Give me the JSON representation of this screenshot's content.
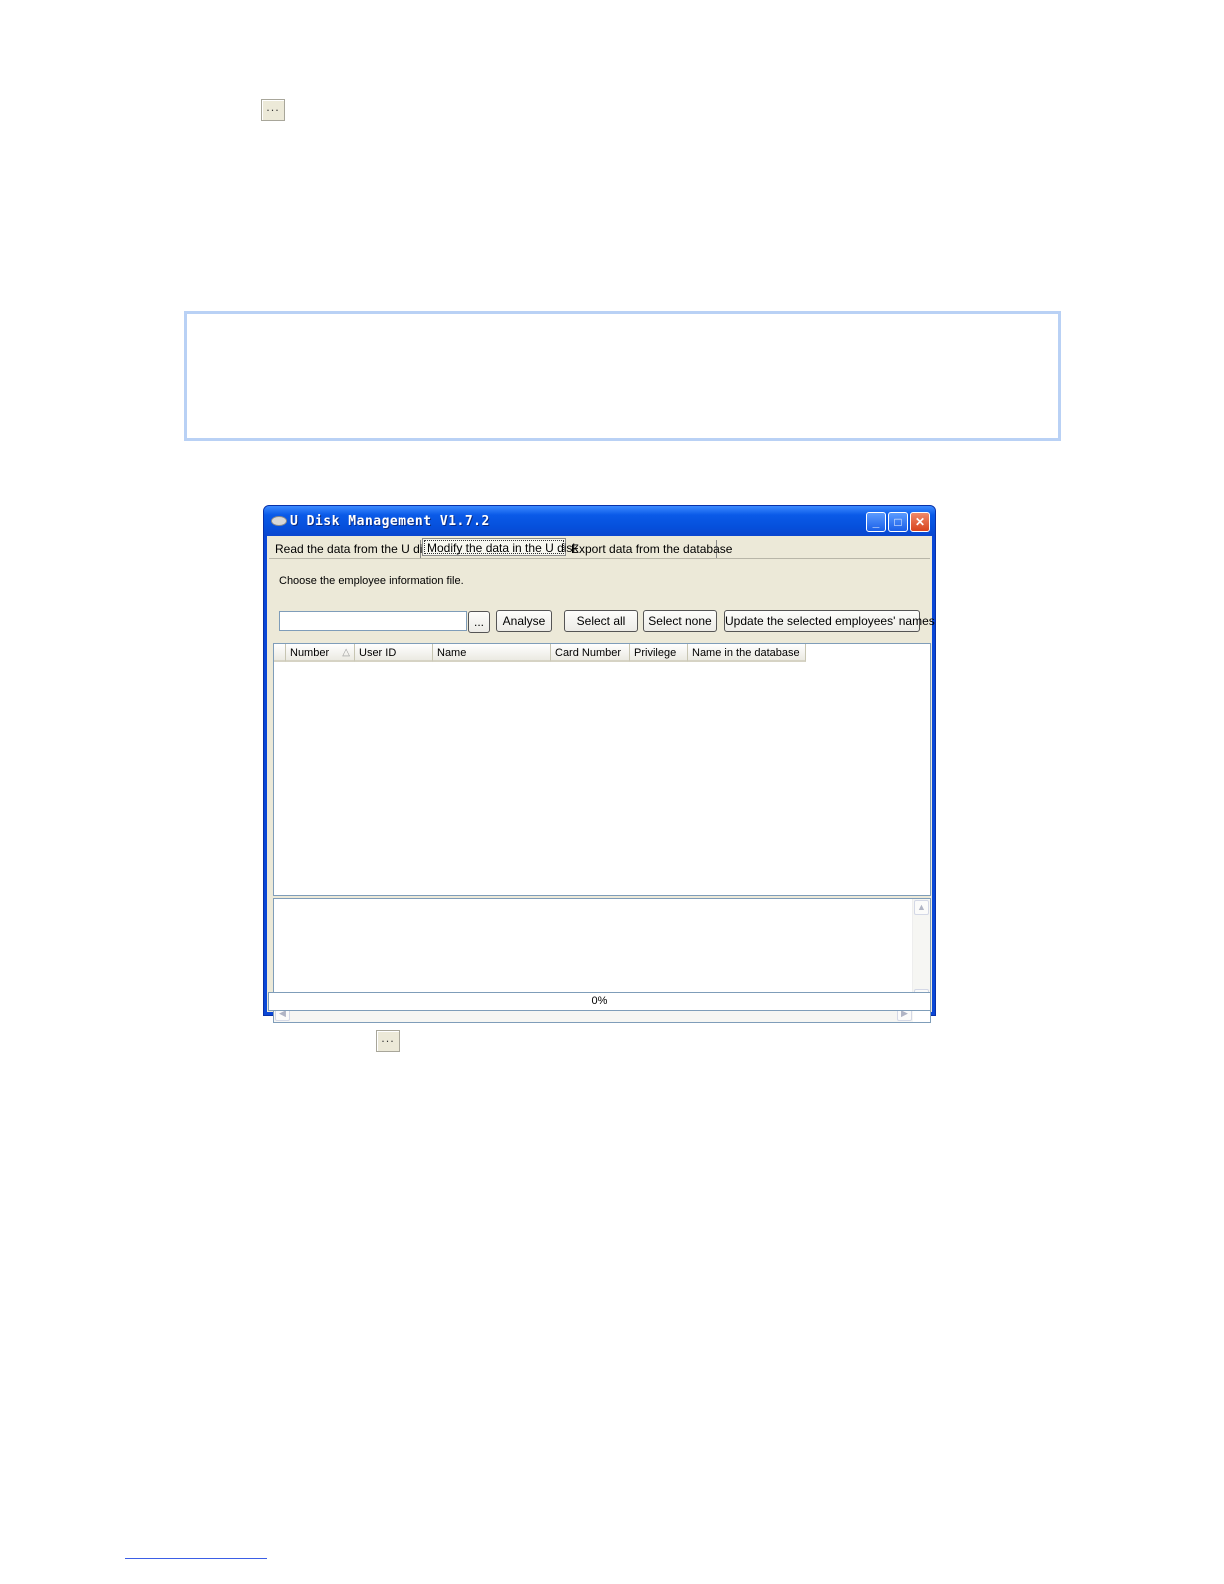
{
  "page": {
    "browse_glyph_top": "...",
    "browse_glyph_bottom": "..."
  },
  "window": {
    "title": "U Disk Management  V1.7.2",
    "controls": {
      "minimize": "_",
      "maximize": "□",
      "close": "✕"
    },
    "tabs": [
      {
        "label": "Read the data from the U disk",
        "active": false
      },
      {
        "label": "Modify the data in the U disk",
        "active": true
      },
      {
        "label": "Export data from the database",
        "active": false
      }
    ],
    "file_label": "Choose the employee information file.",
    "file_input_value": "",
    "browse_button": "...",
    "analyse_button": "Analyse",
    "select_all_button": "Select all",
    "select_none_button": "Select none",
    "update_button": "Update the selected employees' names",
    "columns": [
      "Number",
      "User ID",
      "Name",
      "Card Number",
      "Privilege",
      "Name in the database"
    ],
    "sort_indicator": "△",
    "rows": [],
    "progress_value": 0,
    "progress_text": "0%"
  },
  "colors": {
    "titlebar": "#0a5ae8",
    "note_border": "#b9d1f5",
    "footnote_rule": "#3b5ee6"
  }
}
